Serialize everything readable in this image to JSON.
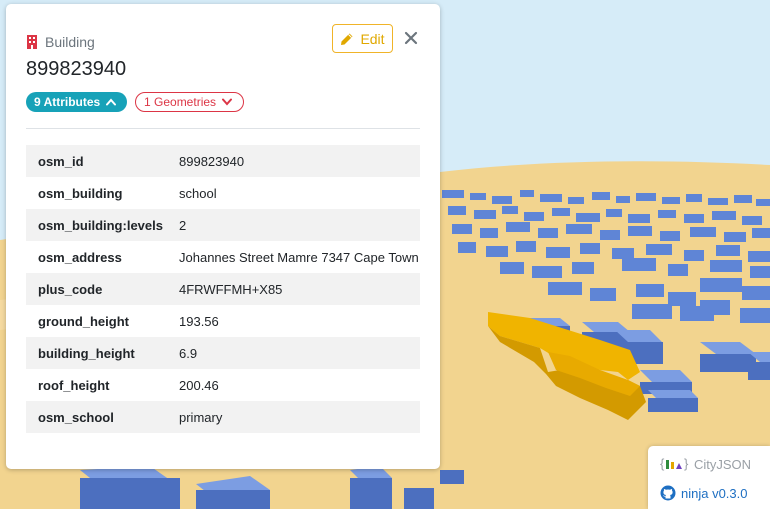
{
  "colors": {
    "sky": "#d6ecf8",
    "ground": "#f2d48f",
    "building": "#5f85d6",
    "highlight": "#e3a600",
    "teal_pill": "#17a2b8",
    "red_pill": "#dc3545",
    "edit_accent": "#e0a800"
  },
  "panel": {
    "type_icon": "building-icon",
    "type_label": "Building",
    "title": "899823940",
    "edit_label": "Edit",
    "close_icon": "close-icon",
    "attributes_label": "9 Attributes",
    "geometries_label": "1 Geometries",
    "attributes": [
      {
        "key": "osm_id",
        "value": "899823940"
      },
      {
        "key": "osm_building",
        "value": "school"
      },
      {
        "key": "osm_building:levels",
        "value": "2"
      },
      {
        "key": "osm_address",
        "value": "Johannes Street Mamre 7347 Cape Town"
      },
      {
        "key": "plus_code",
        "value": "4FRWFFMH+X85"
      },
      {
        "key": "ground_height",
        "value": "193.56"
      },
      {
        "key": "building_height",
        "value": "6.9"
      },
      {
        "key": "roof_height",
        "value": "200.46"
      },
      {
        "key": "osm_school",
        "value": "primary"
      }
    ]
  },
  "badge": {
    "cityjson_label": "CityJSON",
    "ninja_label": "ninja v0.3.0"
  }
}
